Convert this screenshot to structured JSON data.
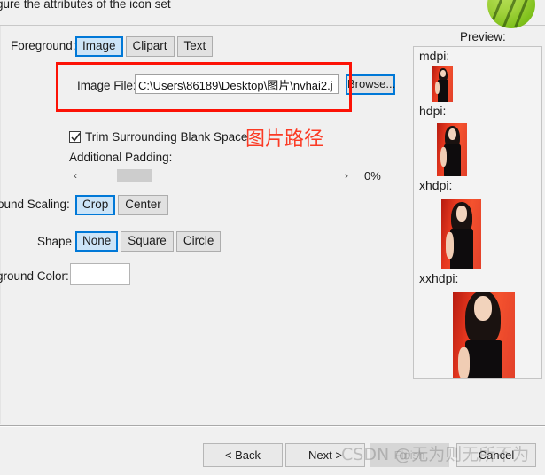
{
  "window": {
    "header_text": "gure the attributes of the icon set",
    "android_icon": "android-logo-icon"
  },
  "form": {
    "foreground_label": "Foreground:",
    "source_tabs": [
      {
        "label": "Image",
        "selected": true
      },
      {
        "label": "Clipart",
        "selected": false
      },
      {
        "label": "Text",
        "selected": false
      }
    ],
    "image_file_label": "Image File:",
    "image_file_value": "C:\\Users\\86189\\Desktop\\图片\\nvhai2.j",
    "image_file_placeholder": "",
    "browse_label": "Browse...",
    "trim_label": "Trim Surrounding Blank Space",
    "trim_checked": true,
    "padding_label": "Additional Padding:",
    "padding_value": "0%",
    "padding_decrease": "‹",
    "padding_increase": "›",
    "scaling_label": "ound Scaling:",
    "scaling_options": [
      {
        "label": "Crop",
        "selected": true
      },
      {
        "label": "Center",
        "selected": false
      }
    ],
    "shape_label": "Shape",
    "shape_options": [
      {
        "label": "None",
        "selected": true
      },
      {
        "label": "Square",
        "selected": false
      },
      {
        "label": "Circle",
        "selected": false
      }
    ],
    "background_color_label": "ground Color:",
    "background_color_value": "#FFFFFF"
  },
  "annotation": {
    "text": "图片路径",
    "color": "#FC1206"
  },
  "preview": {
    "title": "Preview:",
    "items": [
      {
        "label": "mdpi:"
      },
      {
        "label": "hdpi:"
      },
      {
        "label": "xhdpi:"
      },
      {
        "label": "xxhdpi:"
      }
    ]
  },
  "footer": {
    "back_label": "< Back",
    "next_label": "Next >",
    "finish_label": "Finish",
    "cancel_label": "Cancel"
  },
  "watermark": {
    "text": "CSDN @无为则无所不为"
  }
}
